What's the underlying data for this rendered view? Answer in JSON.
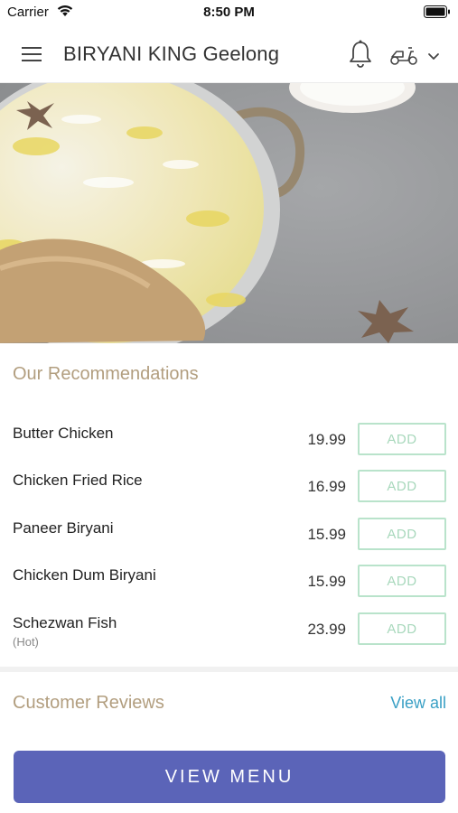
{
  "status_bar": {
    "carrier": "Carrier",
    "time": "8:50 PM"
  },
  "header": {
    "title": "BIRYANI KING Geelong"
  },
  "recommendations": {
    "title": "Our Recommendations",
    "add_label": "ADD",
    "items": [
      {
        "name": "Butter Chicken",
        "note": "",
        "price": "19.99"
      },
      {
        "name": "Chicken Fried Rice",
        "note": "",
        "price": "16.99"
      },
      {
        "name": "Paneer Biryani",
        "note": "",
        "price": "15.99"
      },
      {
        "name": "Chicken Dum Biryani",
        "note": "",
        "price": "15.99"
      },
      {
        "name": "Schezwan Fish",
        "note": "(Hot)",
        "price": "23.99"
      }
    ]
  },
  "reviews": {
    "title": "Customer Reviews",
    "view_all": "View all"
  },
  "footer": {
    "view_menu": "VIEW MENU"
  },
  "colors": {
    "accent": "#5b64b8",
    "section_title": "#b29e7f",
    "add_border": "#b9e3cb",
    "link": "#3aa0c5"
  }
}
